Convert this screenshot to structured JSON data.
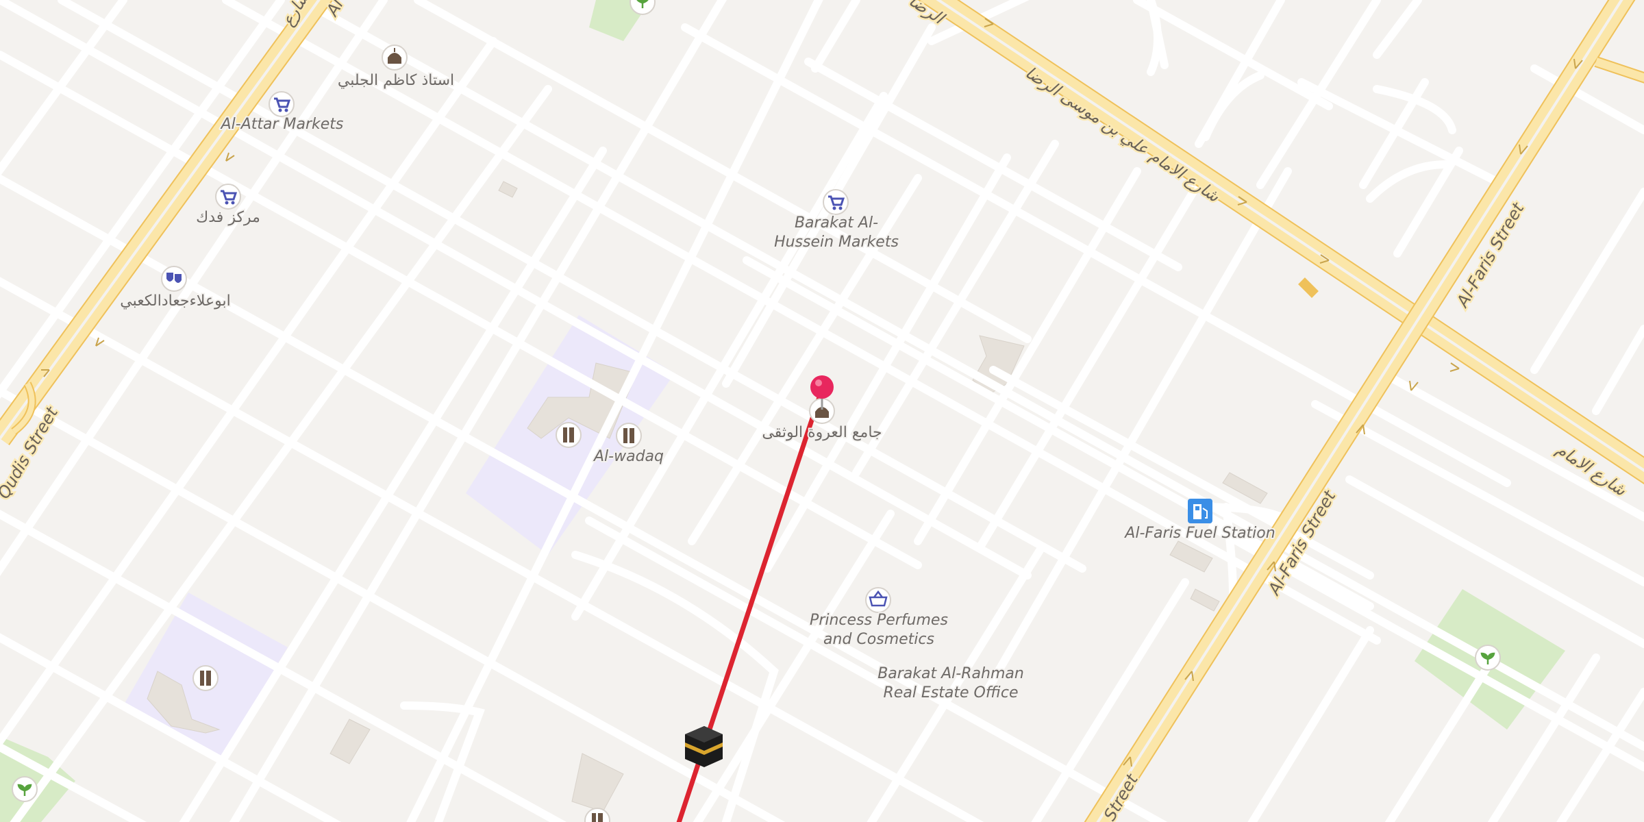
{
  "map": {
    "colors": {
      "background": "#f4f2ef",
      "minor_road": "#ffffff",
      "main_road": "#f7cf73",
      "main_road_fill": "#fbe6a9",
      "school_area": "#ece8fa",
      "park": "#d7ebc6",
      "building": "#e6e1da",
      "route_line": "#dc2430",
      "pin": "#e8275e",
      "poi_shop": "#4b53b3",
      "poi_fuel": "#3a8ee6",
      "poi_park": "#57a33e",
      "poi_religious": "#6a5443"
    },
    "pois": [
      {
        "id": "kazem",
        "label": "استاذ كاظم الجلبي",
        "icon": "mosque-icon"
      },
      {
        "id": "attar",
        "label": "Al-Attar Markets",
        "icon": "shopping-cart-icon"
      },
      {
        "id": "fadak",
        "label": "مركز فدك",
        "icon": "shopping-cart-icon"
      },
      {
        "id": "theatre",
        "label": "ابوعلاءجعادالكعبي",
        "icon": "theatre-masks-icon"
      },
      {
        "id": "barakat_hussein",
        "label_lines": [
          "Barakat Al-",
          "Hussein Markets"
        ],
        "icon": "shopping-cart-icon"
      },
      {
        "id": "mosque_main",
        "label": "جامع العروة الوثقى",
        "icon": "mosque-icon"
      },
      {
        "id": "school_1",
        "label": "",
        "icon": "school-icon"
      },
      {
        "id": "alwadaq",
        "label": "Al-wadaq",
        "icon": "school-icon"
      },
      {
        "id": "fuel",
        "label": "Al-Faris Fuel Station",
        "icon": "fuel-pump-icon"
      },
      {
        "id": "perfumes",
        "label_lines": [
          "Princess Perfumes",
          "and Cosmetics"
        ],
        "icon": "shopping-basket-icon"
      },
      {
        "id": "realestate",
        "label_lines": [
          "Barakat Al-Rahman",
          "Real Estate Office"
        ],
        "icon": ""
      },
      {
        "id": "school_2",
        "label": "",
        "icon": "school-icon"
      },
      {
        "id": "school_3",
        "label": "",
        "icon": "school-icon"
      },
      {
        "id": "park_1",
        "label": "",
        "icon": "park-sprout-icon"
      },
      {
        "id": "park_2",
        "label": "",
        "icon": "park-sprout-icon"
      },
      {
        "id": "park_3",
        "label": "",
        "icon": "park-sprout-icon"
      }
    ],
    "streets": {
      "quds": "Qudis Street",
      "alfaris_1": "Al-Faris Street",
      "alfaris_2": "Al-Faris Street",
      "alfaris_3": "Street",
      "imam_ali": "شارع الامام علي بن موسى الرضا",
      "imam_ali_2": "شارع الامام",
      "top_frag": "الرضا",
      "left_frag_1": "شارع",
      "left_frag_2": "Al"
    },
    "markers": {
      "pin": "location-pin-icon",
      "kaaba": "kaaba-icon"
    }
  }
}
